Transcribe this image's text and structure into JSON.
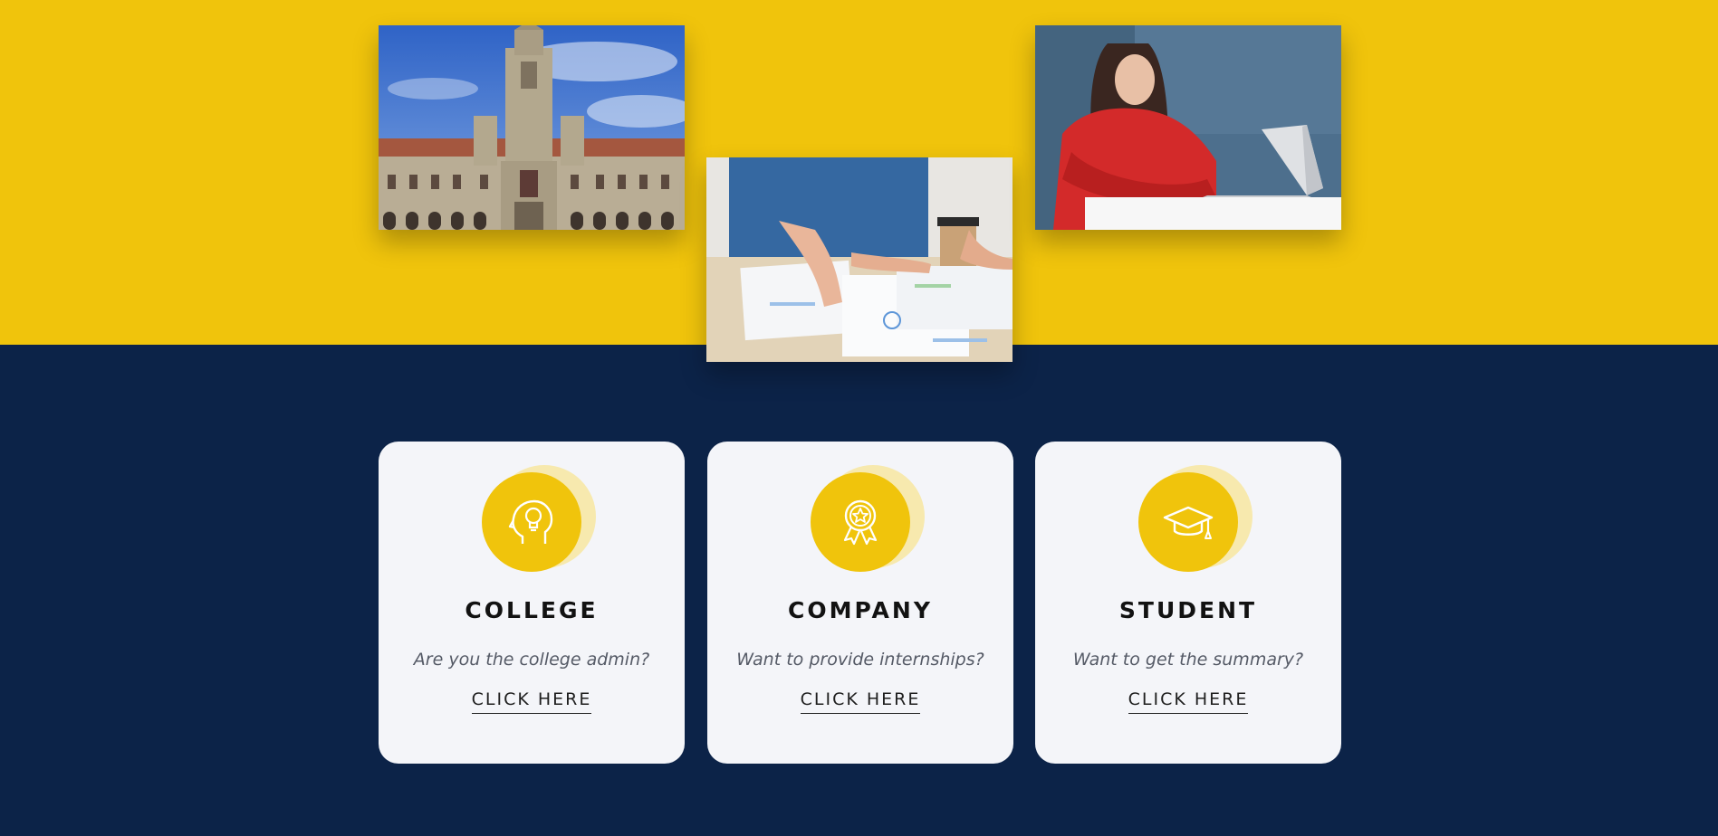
{
  "colors": {
    "accent_yellow": "#f0c40c",
    "navy": "#0c2348",
    "card_bg": "#f4f5f9"
  },
  "photos": [
    {
      "id": "college",
      "subject": "historic college building with clock tower"
    },
    {
      "id": "company",
      "subject": "hands reviewing charts and papers on a desk"
    },
    {
      "id": "student",
      "subject": "student in red sweater using a laptop"
    }
  ],
  "cards": {
    "college": {
      "icon": "head-lightbulb-icon",
      "title": "COLLEGE",
      "subtitle": "Are you the college admin?",
      "cta": "CLICK HERE"
    },
    "company": {
      "icon": "award-badge-icon",
      "title": "COMPANY",
      "subtitle": "Want to provide internships?",
      "cta": "CLICK HERE"
    },
    "student": {
      "icon": "graduation-cap-icon",
      "title": "STUDENT",
      "subtitle": "Want to get the summary?",
      "cta": "CLICK HERE"
    }
  }
}
